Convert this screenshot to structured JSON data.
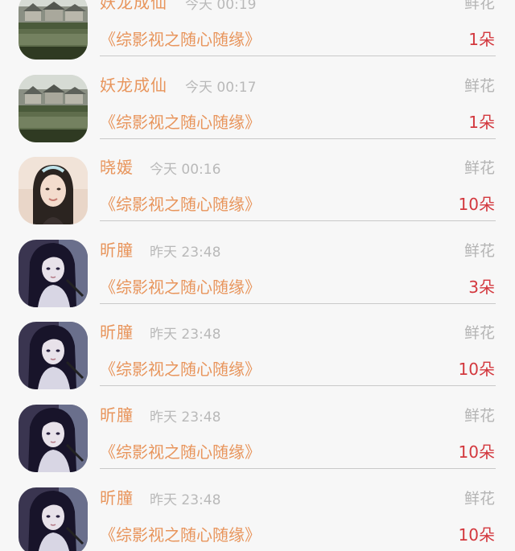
{
  "records": [
    {
      "name": "妖龙成仙",
      "time": "今天 00:19",
      "gift_type": "鲜花",
      "show_title": "《综影视之随心随缘》",
      "gift_count": "1朵",
      "avatar": "landscape-avatar"
    },
    {
      "name": "妖龙成仙",
      "time": "今天 00:17",
      "gift_type": "鲜花",
      "show_title": "《综影视之随心随缘》",
      "gift_count": "1朵",
      "avatar": "landscape-avatar"
    },
    {
      "name": "晓媛",
      "time": "今天 00:16",
      "gift_type": "鲜花",
      "show_title": "《综影视之随心随缘》",
      "gift_count": "10朵",
      "avatar": "girl-photo-avatar"
    },
    {
      "name": "昕朣",
      "time": "昨天 23:48",
      "gift_type": "鲜花",
      "show_title": "《综影视之随心随缘》",
      "gift_count": "3朵",
      "avatar": "anime-girl-avatar"
    },
    {
      "name": "昕朣",
      "time": "昨天 23:48",
      "gift_type": "鲜花",
      "show_title": "《综影视之随心随缘》",
      "gift_count": "10朵",
      "avatar": "anime-girl-avatar"
    },
    {
      "name": "昕朣",
      "time": "昨天 23:48",
      "gift_type": "鲜花",
      "show_title": "《综影视之随心随缘》",
      "gift_count": "10朵",
      "avatar": "anime-girl-avatar"
    },
    {
      "name": "昕朣",
      "time": "昨天 23:48",
      "gift_type": "鲜花",
      "show_title": "《综影视之随心随缘》",
      "gift_count": "10朵",
      "avatar": "anime-girl-avatar"
    }
  ],
  "colors": {
    "name": "#e8955c",
    "time": "#b9b9b9",
    "gift_type": "#b4b4b4",
    "gift_count": "#d3383e",
    "background": "#f7f7f7"
  }
}
